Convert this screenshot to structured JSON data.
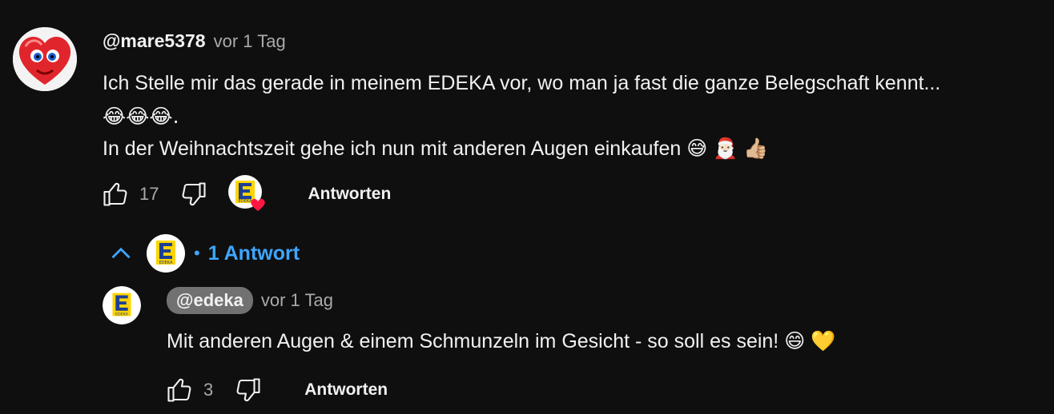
{
  "comment": {
    "author": "@mare5378",
    "time": "vor 1 Tag",
    "lines": [
      "Ich Stelle mir das gerade in meinem EDEKA vor, wo man ja fast die ganze Belegschaft kennt...",
      "😂😂😂.",
      "In der Weihnachtszeit gehe ich nun mit anderen Augen  einkaufen 😅 🎅🏻 👍🏼"
    ],
    "likes": "17",
    "reply_label": "Antworten"
  },
  "replies_toggle": {
    "label": "1 Antwort",
    "bullet": "•"
  },
  "reply": {
    "author": "@edeka",
    "time": "vor 1 Tag",
    "text": "Mit anderen Augen & einem Schmunzeln im Gesicht - so soll es sein! 😄 💛",
    "likes": "3",
    "reply_label": "Antworten"
  },
  "brand": {
    "edeka_text": "EDEKA",
    "edeka_blue": "#1c3f94",
    "edeka_yellow": "#ffd400",
    "link_blue": "#3ea6ff"
  }
}
